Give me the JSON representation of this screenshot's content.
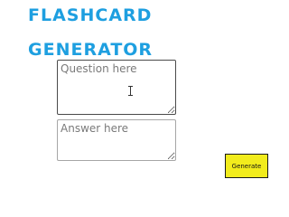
{
  "header": {
    "title_line1": "FLASHCARD",
    "title_line2": "GENERATOR"
  },
  "form": {
    "question": {
      "value": "",
      "placeholder": "Question here"
    },
    "answer": {
      "value": "",
      "placeholder": "Answer here"
    },
    "generate_label": "Generate"
  },
  "icons": {
    "cursor": "text-cursor-icon"
  },
  "colors": {
    "title": "#1e9fe0",
    "button_background": "#f2ec1c",
    "button_border": "#1a1a1a"
  }
}
